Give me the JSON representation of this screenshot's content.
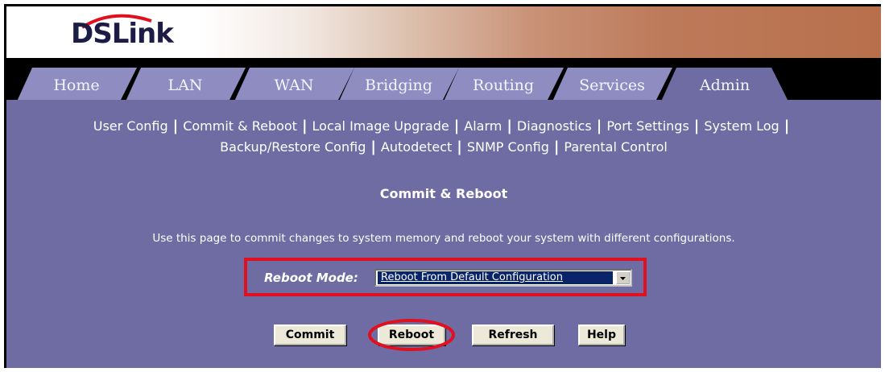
{
  "brand": {
    "logo_text": "DSLink"
  },
  "tabs": [
    {
      "label": "Home"
    },
    {
      "label": "LAN"
    },
    {
      "label": "WAN"
    },
    {
      "label": "Bridging"
    },
    {
      "label": "Routing"
    },
    {
      "label": "Services"
    },
    {
      "label": "Admin",
      "active": true
    }
  ],
  "subnav": [
    "User Config",
    "Commit & Reboot",
    "Local Image Upgrade",
    "Alarm",
    "Diagnostics",
    "Port Settings",
    "System Log",
    "Backup/Restore Config",
    "Autodetect",
    "SNMP Config",
    "Parental Control"
  ],
  "page": {
    "title": "Commit & Reboot",
    "description": "Use this page to commit changes to system memory and reboot your system with different configurations."
  },
  "form": {
    "reboot_mode_label": "Reboot Mode:",
    "reboot_mode_value": "Reboot From Default Configuration"
  },
  "buttons": {
    "commit": "Commit",
    "reboot": "Reboot",
    "refresh": "Refresh",
    "help": "Help"
  },
  "colors": {
    "panel": "#6e6ca3",
    "tab": "#8e8cc0",
    "highlight": "#e01020"
  }
}
